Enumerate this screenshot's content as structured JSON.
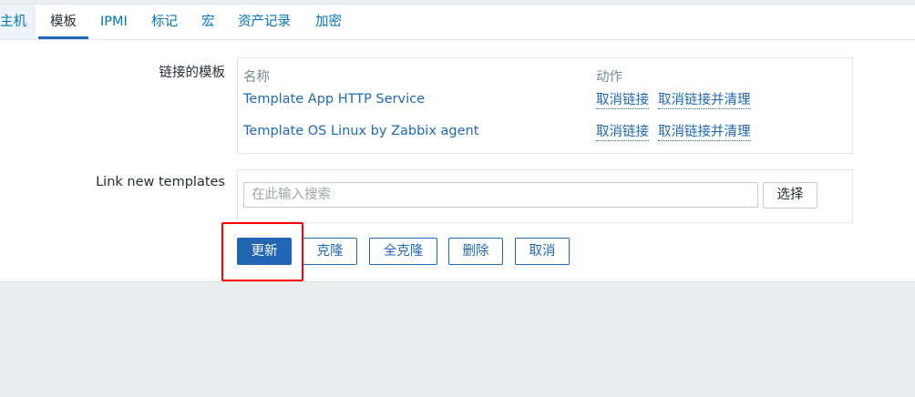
{
  "tabs": [
    {
      "label": "主机"
    },
    {
      "label": "模板"
    },
    {
      "label": "IPMI"
    },
    {
      "label": "标记"
    },
    {
      "label": "宏"
    },
    {
      "label": "资产记录"
    },
    {
      "label": "加密"
    }
  ],
  "active_tab": "模板",
  "linked_templates": {
    "label": "链接的模板",
    "headers": {
      "name": "名称",
      "action": "动作"
    },
    "rows": [
      {
        "name": "Template App HTTP Service",
        "unlink": "取消链接",
        "unlink_clear": "取消链接并清理"
      },
      {
        "name": "Template OS Linux by Zabbix agent",
        "unlink": "取消链接",
        "unlink_clear": "取消链接并清理"
      }
    ]
  },
  "link_new": {
    "label": "Link new templates",
    "placeholder": "在此输入搜索",
    "select_button": "选择"
  },
  "buttons": {
    "update": "更新",
    "clone": "克隆",
    "full_clone": "全克隆",
    "delete": "删除",
    "cancel": "取消"
  },
  "colors": {
    "link": "#1f68b5",
    "primary_button": "#2365b5",
    "highlight": "#ff0000"
  }
}
